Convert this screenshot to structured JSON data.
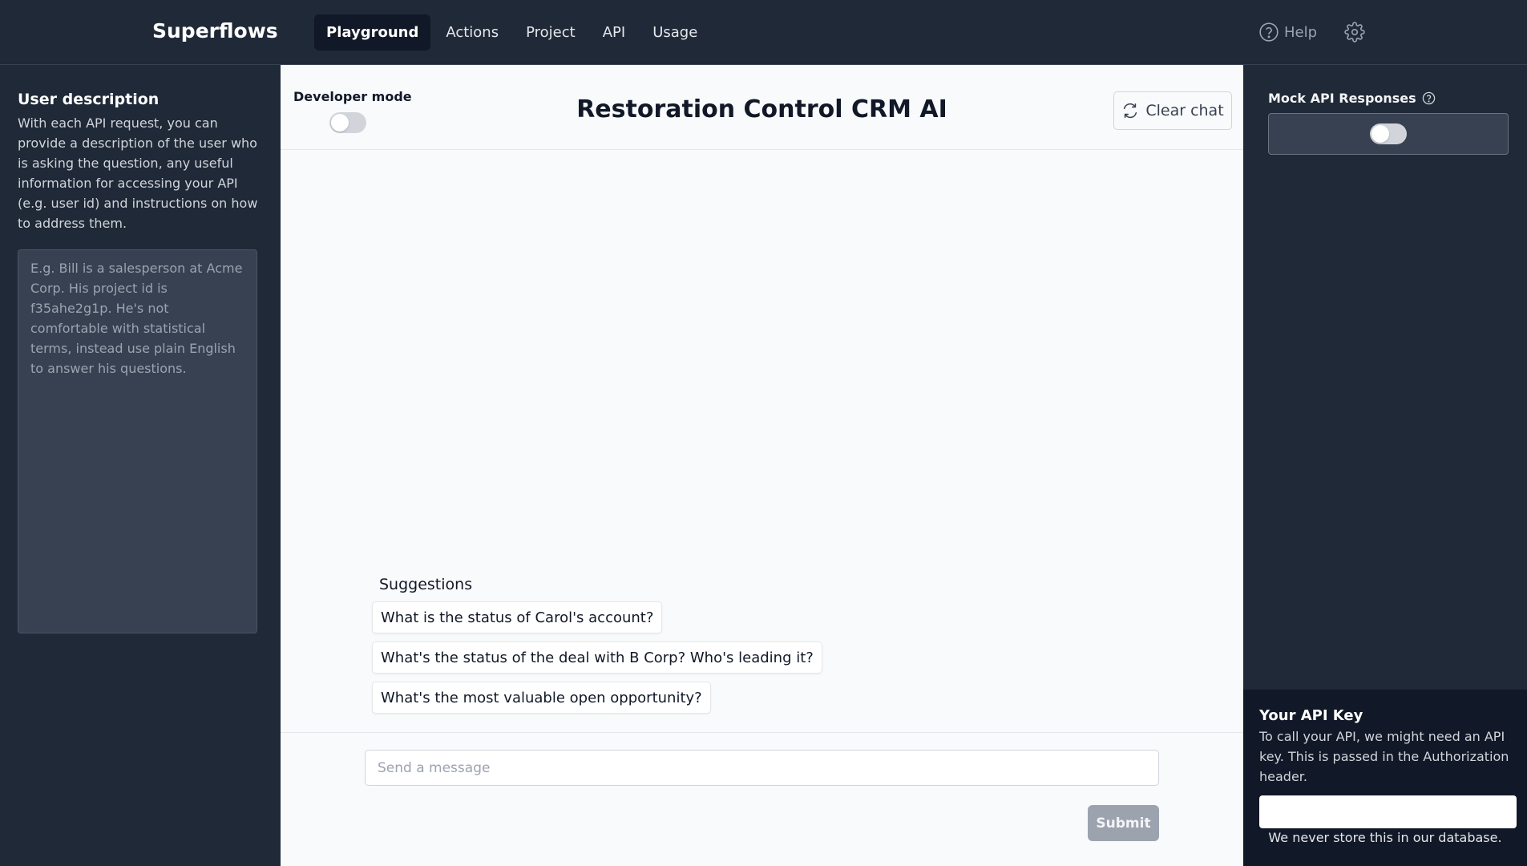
{
  "brand": "Superflows",
  "nav": {
    "tabs": [
      {
        "label": "Playground",
        "active": true
      },
      {
        "label": "Actions",
        "active": false
      },
      {
        "label": "Project",
        "active": false
      },
      {
        "label": "API",
        "active": false
      },
      {
        "label": "Usage",
        "active": false
      }
    ],
    "help_label": "Help",
    "help_icon": "question-circle-icon",
    "settings_icon": "gear-icon"
  },
  "left": {
    "title": "User description",
    "description": "With each API request, you can provide a description of the user who is asking the question, any useful information for accessing your API (e.g. user id) and instructions on how to address them.",
    "textarea_placeholder": "E.g. Bill is a salesperson at Acme Corp. His project id is f35ahe2g1p. He's not comfortable with statistical terms, instead use plain English to answer his questions.",
    "textarea_value": ""
  },
  "center": {
    "developer_mode_label": "Developer mode",
    "developer_mode_on": false,
    "title": "Restoration Control CRM AI",
    "clear_chat_label": "Clear chat",
    "suggestions_title": "Suggestions",
    "suggestions": [
      "What is the status of Carol's account?",
      "What's the status of the deal with B Corp? Who's leading it?",
      "What's the most valuable open opportunity?"
    ],
    "message_placeholder": "Send a message",
    "message_value": "",
    "submit_label": "Submit"
  },
  "right": {
    "mock_label": "Mock API Responses",
    "mock_on": false,
    "api_key_title": "Your API Key",
    "api_key_description": "To call your API, we might need an API key. This is passed in the Authorization header.",
    "api_key_value": "",
    "api_key_note": "We never store this in our database."
  },
  "colors": {
    "background_dark": "#1f2937",
    "panel_light": "#f9fafb",
    "active_tab": "#111827",
    "submit_disabled": "#9ca3af"
  }
}
